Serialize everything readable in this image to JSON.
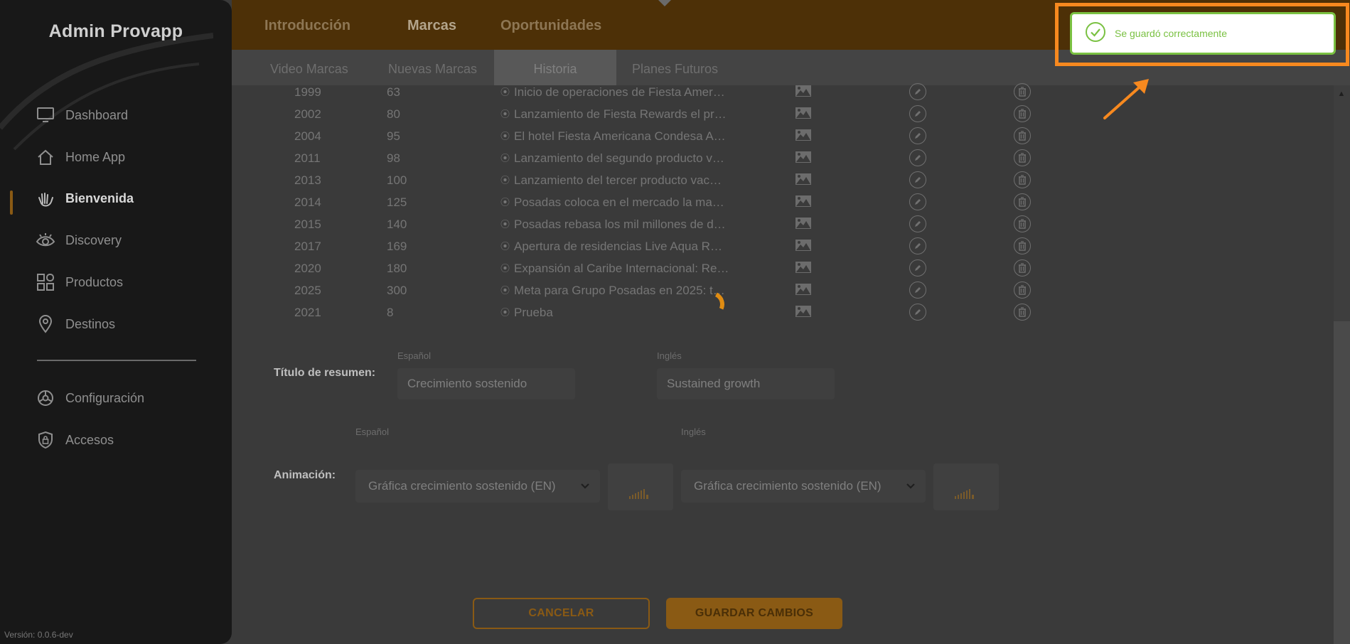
{
  "app": {
    "title": "Admin Provapp",
    "version": "Versión: 0.0.6-dev"
  },
  "sidebar": {
    "items": [
      {
        "label": "Dashboard",
        "icon": "monitor-icon"
      },
      {
        "label": "Home App",
        "icon": "house-icon"
      },
      {
        "label": "Bienvenida",
        "icon": "waving-hand-icon",
        "active": true
      },
      {
        "label": "Discovery",
        "icon": "eye-icon"
      },
      {
        "label": "Productos",
        "icon": "grid-icon"
      },
      {
        "label": "Destinos",
        "icon": "map-pin-icon"
      }
    ],
    "bottom_items": [
      {
        "label": "Configuración",
        "icon": "gear-icon"
      },
      {
        "label": "Accesos",
        "icon": "shield-lock-icon"
      }
    ]
  },
  "topnav": {
    "tabs": [
      "Introducción",
      "Marcas",
      "Oportunidades"
    ],
    "active": "Marcas"
  },
  "subnav": {
    "tabs": [
      "Video Marcas",
      "Nuevas Marcas",
      "Historia",
      "Planes Futuros"
    ],
    "active": "Historia"
  },
  "table": {
    "rows": [
      {
        "year": "1999",
        "value": "63",
        "description": "Inicio de operaciones de Fiesta Amer…"
      },
      {
        "year": "2002",
        "value": "80",
        "description": "Lanzamiento de Fiesta Rewards el pr…"
      },
      {
        "year": "2004",
        "value": "95",
        "description": "El hotel Fiesta Americana Condesa A…"
      },
      {
        "year": "2011",
        "value": "98",
        "description": "Lanzamiento del segundo producto v…"
      },
      {
        "year": "2013",
        "value": "100",
        "description": "Lanzamiento del tercer producto vac…"
      },
      {
        "year": "2014",
        "value": "125",
        "description": "Posadas coloca en el mercado la ma…"
      },
      {
        "year": "2015",
        "value": "140",
        "description": "Posadas rebasa los mil millones de d…"
      },
      {
        "year": "2017",
        "value": "169",
        "description": "Apertura de residencias Live Aqua R…"
      },
      {
        "year": "2020",
        "value": "180",
        "description": "Expansión al Caribe Internacional: Re…"
      },
      {
        "year": "2025",
        "value": "300",
        "description": "Meta para Grupo Posadas en 2025: t…"
      },
      {
        "year": "2021",
        "value": "8",
        "description": "Prueba"
      }
    ]
  },
  "summary": {
    "label": "Título de resumen:",
    "es_label": "Español",
    "en_label": "Inglés",
    "es_value": "Crecimiento sostenido",
    "en_value": "Sustained growth"
  },
  "animation": {
    "label": "Animación:",
    "es_label": "Español",
    "en_label": "Inglés",
    "es_selected": "Gráfica crecimiento sostenido (EN)",
    "en_selected": "Gráfica crecimiento sostenido (EN)"
  },
  "buttons": {
    "cancel": "CANCELAR",
    "save": "GUARDAR CAMBIOS"
  },
  "toast": {
    "message": "Se guardó correctamente",
    "color": "#7ac142",
    "highlight_color": "#f7891f"
  },
  "colors": {
    "brand": "#e08c12",
    "sidebar_bg": "#181818"
  }
}
